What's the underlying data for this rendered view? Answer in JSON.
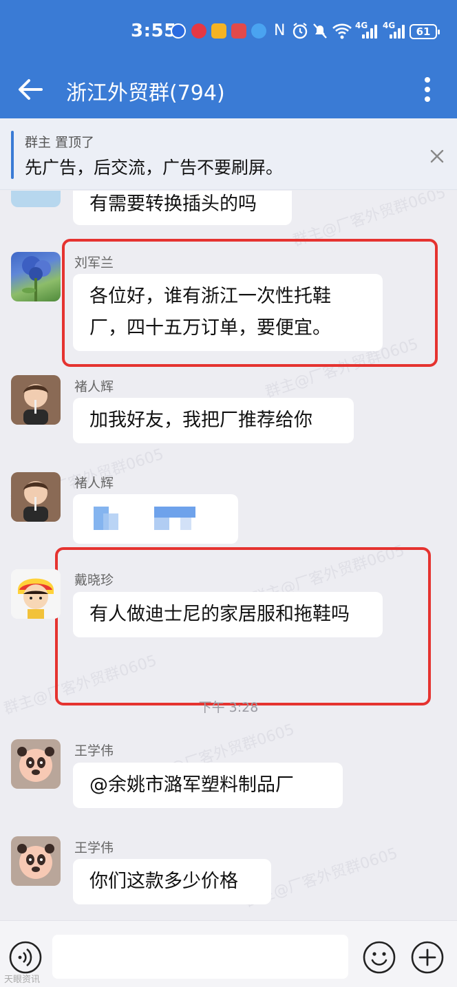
{
  "status_bar": {
    "time": "3:55",
    "network_1": "4G",
    "network_2": "4G",
    "battery": "61"
  },
  "header": {
    "title": "浙江外贸群(794)"
  },
  "pinned": {
    "who": "群主 置顶了",
    "text": "先广告，后交流，广告不要刷屏。"
  },
  "messages": [
    {
      "sender": "",
      "text": "有需要转换插头的吗"
    },
    {
      "sender": "刘军兰",
      "text": "各位好，谁有浙江一次性托鞋厂，四十五万订单，要便宜。"
    },
    {
      "sender": "褚人辉",
      "text": "加我好友，我把厂推荐给你"
    },
    {
      "sender": "褚人辉",
      "text": ""
    },
    {
      "sender": "戴晓珍",
      "text": "有人做迪士尼的家居服和拖鞋吗"
    },
    {
      "sender": "王学伟",
      "text": "@余姚市潞军塑料制品厂"
    },
    {
      "sender": "王学伟",
      "text": "你们这款多少价格"
    }
  ],
  "timestamp": "下午 3:28",
  "watermark": "群主@厂客外贸群0605",
  "corner_logo": "天眼资讯",
  "colors": {
    "header_blue": "#3a7bd5",
    "highlight_red": "#e53330",
    "chat_bg": "#ededf2"
  },
  "icons": [
    "back-arrow-icon",
    "more-vertical-icon",
    "close-icon",
    "voice-icon",
    "emoji-icon",
    "plus-icon"
  ]
}
